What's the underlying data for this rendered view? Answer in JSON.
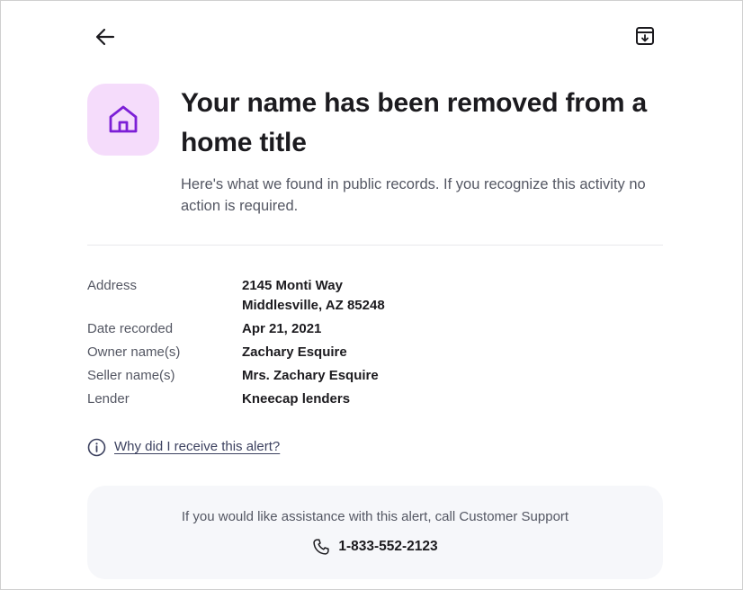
{
  "header": {
    "back_icon": "arrow-left-icon",
    "archive_icon": "archive-download-icon"
  },
  "alert": {
    "icon": "home-icon",
    "accent_color": "#7c1fd6",
    "badge_color": "#f5dcfb",
    "title": "Your name has been removed from a home title",
    "subtitle": "Here's what we found in public records. If you recognize this activity no action is required."
  },
  "details": {
    "address_label": "Address",
    "address_line1": "2145 Monti Way",
    "address_line2": "Middlesville, AZ 85248",
    "date_label": "Date recorded",
    "date_value": "Apr 21, 2021",
    "owner_label": "Owner name(s)",
    "owner_value": "Zachary Esquire",
    "seller_label": "Seller name(s)",
    "seller_value": "Mrs. Zachary Esquire",
    "lender_label": "Lender",
    "lender_value": "Kneecap lenders"
  },
  "info": {
    "icon": "info-circle-icon",
    "link_text": "Why did I receive this alert?"
  },
  "support": {
    "text": "If you would like assistance with this alert, call Customer Support",
    "phone_icon": "phone-icon",
    "phone": "1-833-552-2123"
  }
}
